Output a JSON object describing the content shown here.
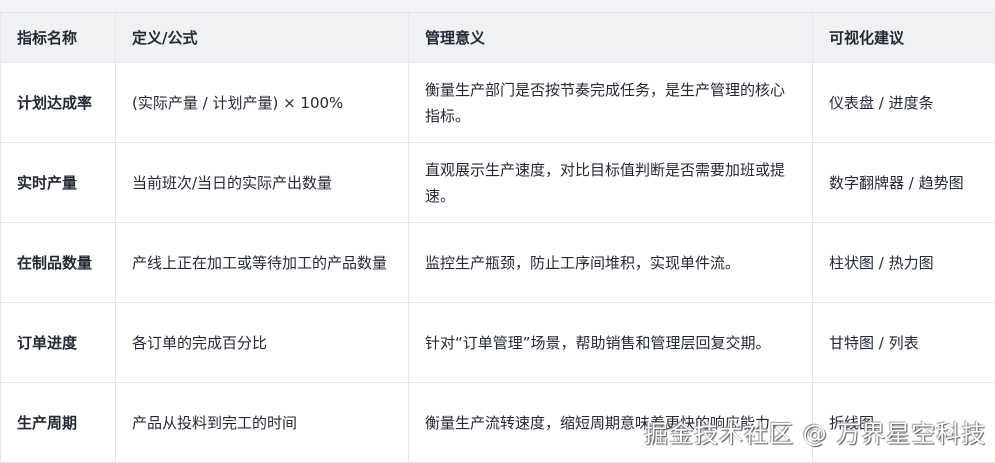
{
  "headers": [
    "指标名称",
    "定义/公式",
    "管理意义",
    "可视化建议"
  ],
  "rows": [
    {
      "name": "计划达成率",
      "definition": "(实际产量 / 计划产量) × 100%",
      "meaning": "衡量生产部门是否按节奏完成任务，是生产管理的核心指标。",
      "visual": "仪表盘 / 进度条"
    },
    {
      "name": "实时产量",
      "definition": "当前班次/当日的实际产出数量",
      "meaning": "直观展示生产速度，对比目标值判断是否需要加班或提速。",
      "visual": "数字翻牌器 / 趋势图"
    },
    {
      "name": "在制品数量",
      "definition": "产线上正在加工或等待加工的产品数量",
      "meaning": "监控生产瓶颈，防止工序间堆积，实现单件流。",
      "visual": "柱状图 / 热力图"
    },
    {
      "name": "订单进度",
      "definition": "各订单的完成百分比",
      "meaning": "针对“订单管理”场景，帮助销售和管理层回复交期。",
      "visual": "甘特图 / 列表"
    },
    {
      "name": "生产周期",
      "definition": "产品从投料到完工的时间",
      "meaning": "衡量生产流转速度，缩短周期意味着更快的响应能力。",
      "visual": "折线图"
    }
  ],
  "watermark": "掘金技术社区 @ 万界星空科技"
}
